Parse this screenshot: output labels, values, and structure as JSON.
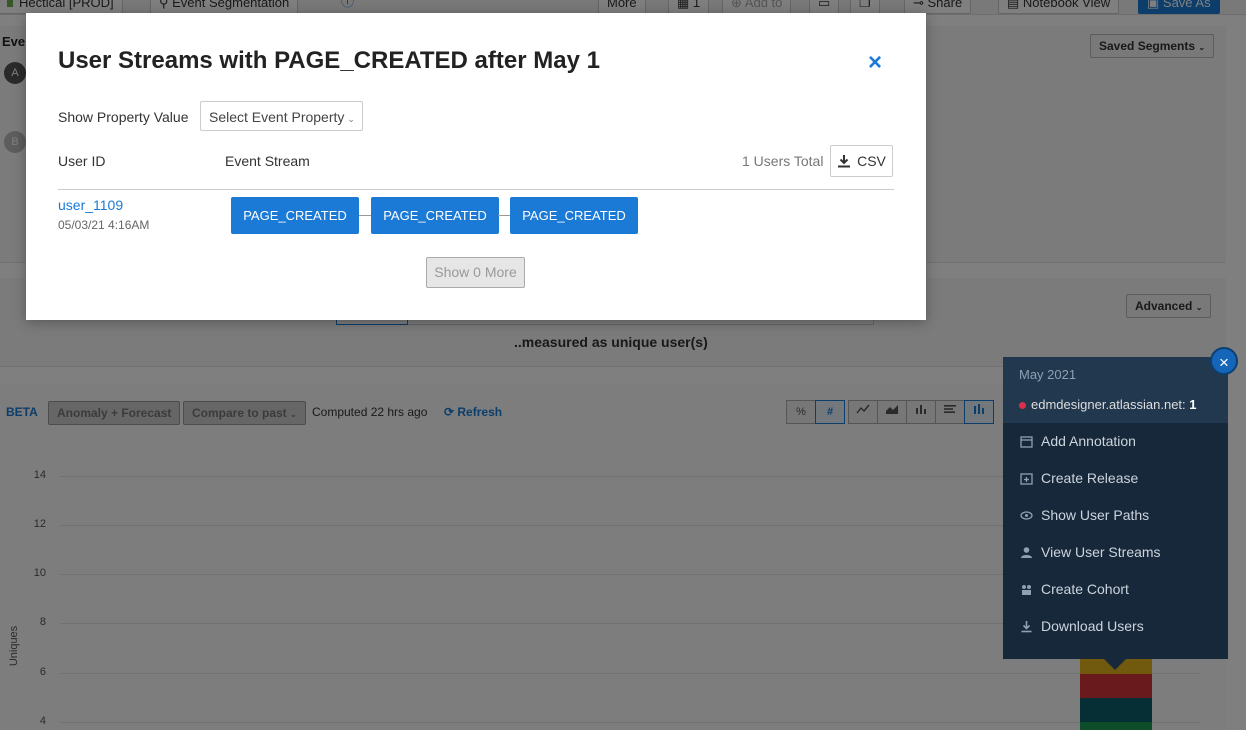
{
  "topbar": {
    "project_label": "Hectical [PROD]",
    "segmentation_label": "Event Segmentation",
    "more_label": "More",
    "count_label": "1",
    "add_to_label": "Add to",
    "share_label": "Share",
    "notebook_label": "Notebook View",
    "save_as_label": "Save As"
  },
  "background": {
    "events_label": "Eve",
    "event_a": "A",
    "event_b": "B",
    "saved_segments_label": "Saved Segments",
    "advanced_label": "Advanced",
    "measured_label": "..measured as unique user(s)",
    "beta_label": "BETA",
    "anomaly_label": "Anomaly + Forecast",
    "compare_label": "Compare to past",
    "computed_label": "Computed 22 hrs ago",
    "refresh_label": "Refresh",
    "view_percent": "%",
    "view_number": "#",
    "y_axis_label": "Uniques",
    "y_ticks": [
      "14",
      "12",
      "10",
      "8",
      "6",
      "4"
    ]
  },
  "context_menu": {
    "month": "May 2021",
    "site": "edmdesigner.atlassian.net:",
    "site_count": "1",
    "items": [
      {
        "label": "Add Annotation",
        "icon": "calendar-icon"
      },
      {
        "label": "Create Release",
        "icon": "calendar-plus-icon"
      },
      {
        "label": "Show User Paths",
        "icon": "eye-icon"
      },
      {
        "label": "View User Streams",
        "icon": "user-icon"
      },
      {
        "label": "Create Cohort",
        "icon": "cohort-icon"
      },
      {
        "label": "Download Users",
        "icon": "download-icon"
      }
    ],
    "close_glyph": "×"
  },
  "modal": {
    "title": "User Streams with PAGE_CREATED after May 1",
    "close_glyph": "×",
    "show_property_label": "Show Property Value",
    "select_placeholder": "Select Event Property",
    "col_user_id": "User ID",
    "col_event_stream": "Event Stream",
    "users_total": "1 Users Total",
    "csv_label": "CSV",
    "rows": [
      {
        "user_id": "user_1109",
        "timestamp": "05/03/21 4:16AM",
        "events": [
          "PAGE_CREATED",
          "PAGE_CREATED",
          "PAGE_CREATED"
        ]
      }
    ],
    "show_more_label": "Show 0 More"
  },
  "colors": {
    "accent": "#1a7ad6",
    "menu_bg": "#16283a",
    "bar_yellow": "#e2b51c",
    "bar_red": "#d0343a",
    "bar_teal": "#0d5e6b",
    "bar_green": "#1b9b52"
  }
}
